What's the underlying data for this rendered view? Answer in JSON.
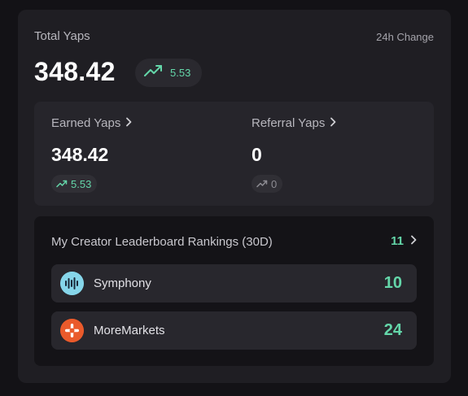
{
  "total": {
    "label": "Total Yaps",
    "change_label": "24h Change",
    "value": "348.42",
    "change": "5.53"
  },
  "earned": {
    "label": "Earned Yaps",
    "value": "348.42",
    "change": "5.53"
  },
  "referral": {
    "label": "Referral Yaps",
    "value": "0",
    "change": "0"
  },
  "leaderboard": {
    "title": "My Creator Leaderboard Rankings (30D)",
    "count": "11",
    "items": [
      {
        "name": "Symphony",
        "rank": "10",
        "icon": "symphony-logo"
      },
      {
        "name": "MoreMarkets",
        "rank": "24",
        "icon": "moremarkets-logo"
      }
    ]
  },
  "colors": {
    "accent_green": "#64d6a9",
    "card_bg": "#1f1e23",
    "page_bg": "#131216"
  }
}
